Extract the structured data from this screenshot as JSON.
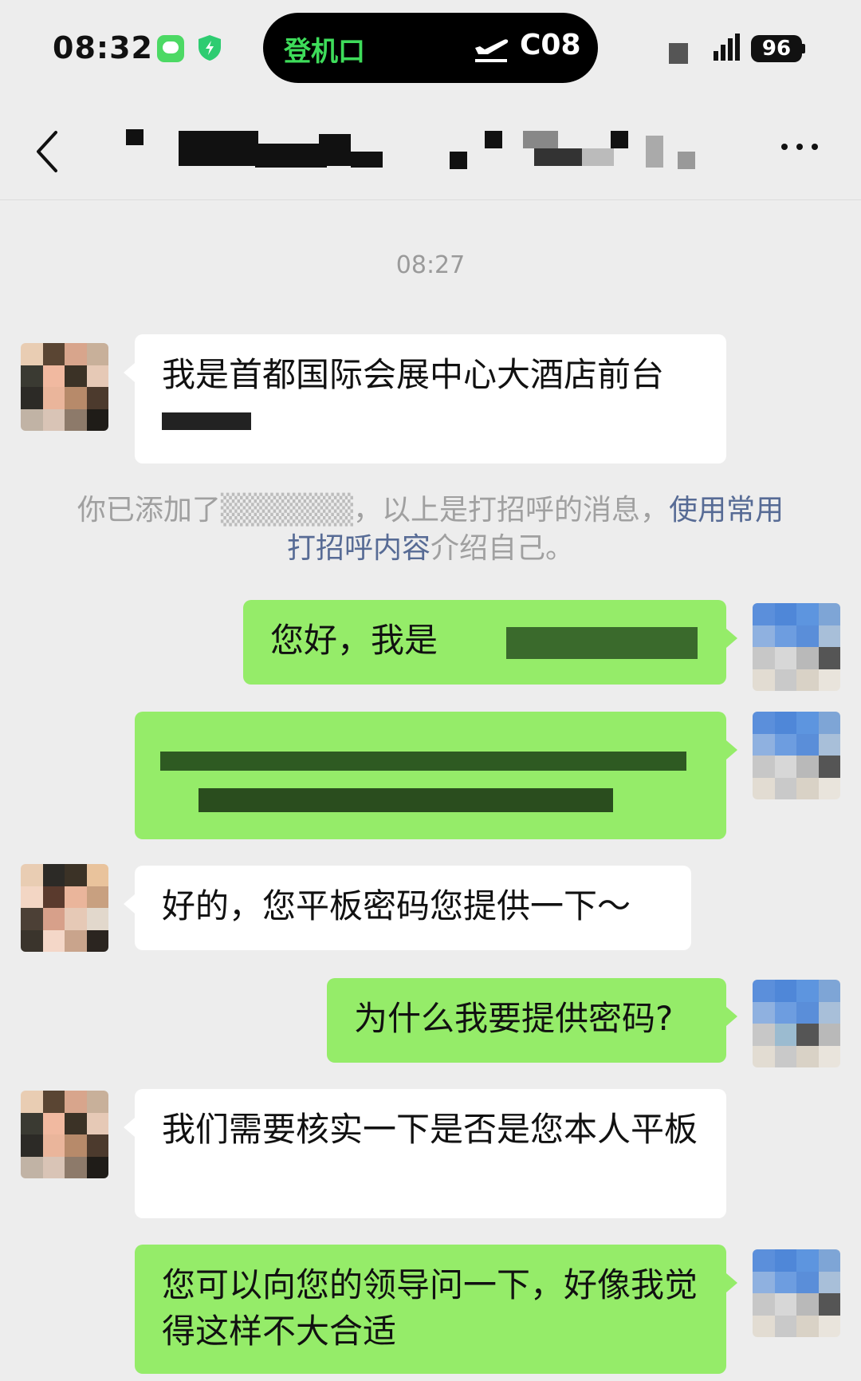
{
  "status": {
    "time": "08:32",
    "island_label": "登机口",
    "gate": "C08",
    "battery": "96"
  },
  "chat": {
    "timestamp": "08:27",
    "system_note": {
      "before": "你已添加了",
      "after": "，以上是打招呼的消息，",
      "link1": "使用常用打招呼内容",
      "after2": "介绍自己。"
    },
    "messages": [
      {
        "side": "left",
        "text": "我是首都国际会展中心大酒店前台"
      },
      {
        "side": "right",
        "text": "您好，我是"
      },
      {
        "side": "right",
        "text": ""
      },
      {
        "side": "left",
        "text": "好的，您平板密码您提供一下～"
      },
      {
        "side": "right",
        "text": "为什么我要提供密码?"
      },
      {
        "side": "left",
        "text": "我们需要核实一下是否是您本人平板"
      },
      {
        "side": "right",
        "text": "您可以向您的领导问一下，好像我觉得这样不大合适"
      }
    ]
  },
  "colors": {
    "background": "#ededed",
    "bubble_self": "#95ec69",
    "bubble_other": "#ffffff",
    "link": "#576b95",
    "island_text": "#3edc5a"
  }
}
